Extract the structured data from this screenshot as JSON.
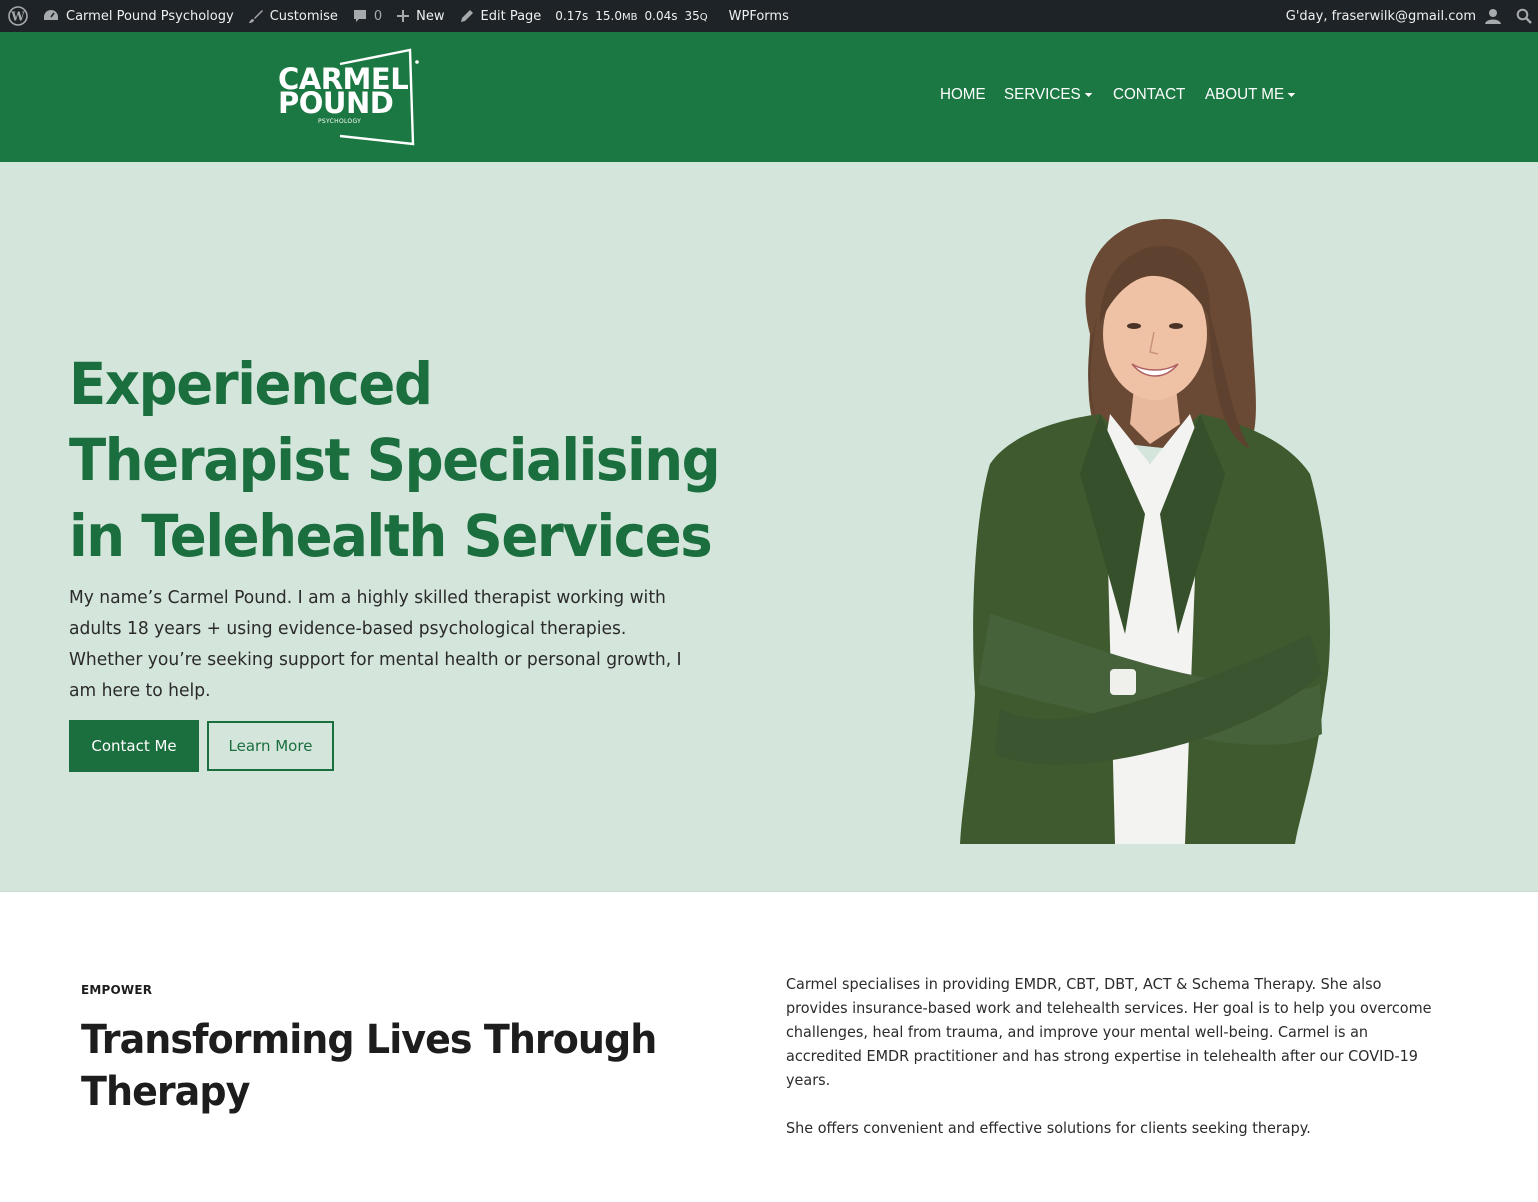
{
  "admin_bar": {
    "site_name": "Carmel Pound Psychology",
    "customise": "Customise",
    "comments_count": "0",
    "new_label": "New",
    "edit_page": "Edit Page",
    "metric_time": "0.17s",
    "metric_mem": "15.0",
    "metric_mem_unit": "MB",
    "metric_time2": "0.04s",
    "metric_queries": "35",
    "metric_queries_unit": "Q",
    "wpforms": "WPForms",
    "greeting": "G'day, fraserwilk@gmail.com"
  },
  "header": {
    "logo_line1": "CARMEL",
    "logo_line2": "POUND",
    "logo_sub": "PSYCHOLOGY",
    "nav": [
      {
        "label": "HOME"
      },
      {
        "label": "SERVICES"
      },
      {
        "label": "CONTACT"
      },
      {
        "label": "ABOUT ME"
      }
    ]
  },
  "hero": {
    "title": "Experienced Therapist Specialising in Telehealth Services",
    "text": "My name’s Carmel Pound. I am a highly skilled therapist working with adults 18 years + using evidence-based psychological therapies. Whether you’re seeking support for mental health or personal growth, I am here to help.",
    "primary_button": "Contact Me",
    "secondary_button": "Learn More"
  },
  "intro": {
    "eyebrow": "EMPOWER",
    "title": "Transforming Lives Through Therapy",
    "paragraphs": [
      "Carmel specialises in providing EMDR, CBT, DBT, ACT & Schema Therapy. She also provides insurance-based work and telehealth services. Her goal is to help you overcome challenges, heal from trauma, and improve your mental well-being. Carmel is an accredited EMDR practitioner and has strong expertise in telehealth after our COVID-19 years.",
      "She offers convenient and effective solutions for clients seeking therapy."
    ]
  },
  "colors": {
    "admin_bar_bg": "#1d2327",
    "brand_green": "#1b7842",
    "hero_bg": "#d4e6dc",
    "heading_green": "#1b6e3e"
  }
}
